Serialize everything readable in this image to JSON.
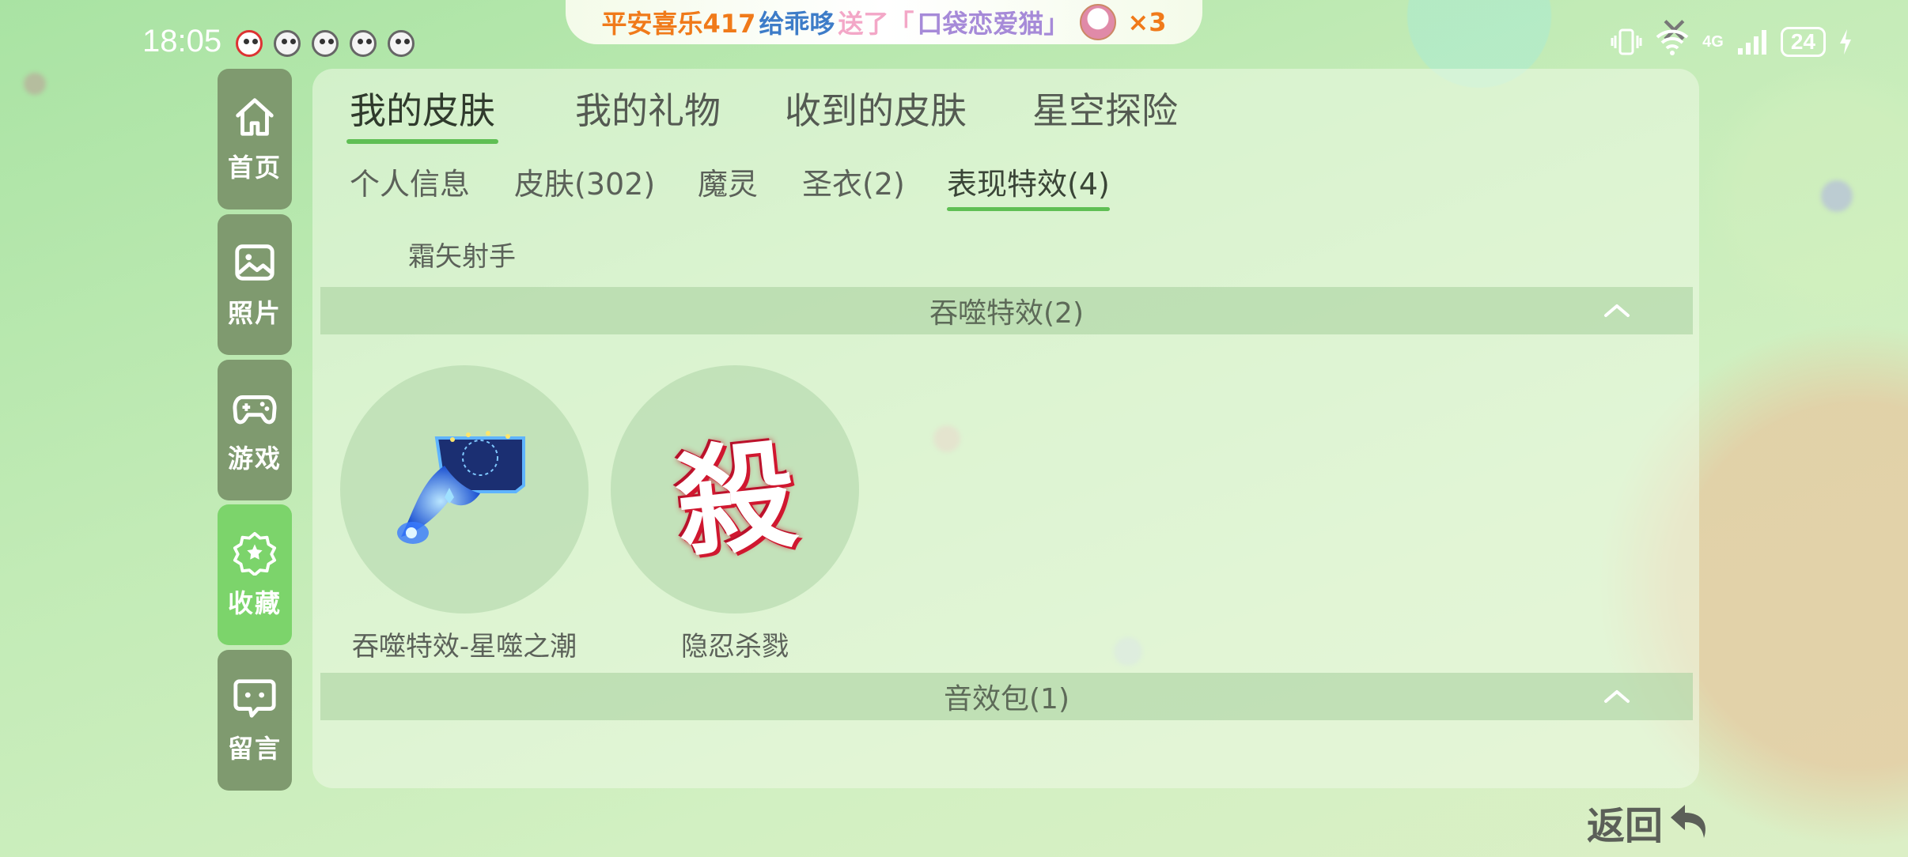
{
  "status_bar": {
    "time": "18:05",
    "network": "4G",
    "battery": "24"
  },
  "gift_banner": {
    "user": "平安喜乐417",
    "verb": "给乖哆",
    "action": "送了「",
    "item": "口袋恋爱猫」",
    "count": "×3"
  },
  "sidebar": {
    "items": [
      {
        "label": "首页",
        "icon": "home-icon"
      },
      {
        "label": "照片",
        "icon": "image-icon"
      },
      {
        "label": "游戏",
        "icon": "gamepad-icon"
      },
      {
        "label": "收藏",
        "icon": "star-badge-icon",
        "active": true
      },
      {
        "label": "留言",
        "icon": "message-icon"
      }
    ]
  },
  "main_tabs": [
    {
      "label": "我的皮肤",
      "active": true
    },
    {
      "label": "我的礼物"
    },
    {
      "label": "收到的皮肤"
    },
    {
      "label": "星空探险"
    }
  ],
  "sub_tabs": [
    {
      "label": "个人信息"
    },
    {
      "label": "皮肤(302)"
    },
    {
      "label": "魔灵"
    },
    {
      "label": "圣衣(2)"
    },
    {
      "label": "表现特效(4)",
      "active": true
    }
  ],
  "character_name": "霜矢射手",
  "sections": [
    {
      "title": "吞噬特效(2)",
      "expanded": true,
      "items": [
        {
          "label": "吞噬特效-星噬之潮",
          "icon": "star-tide-effect-icon"
        },
        {
          "label": "隐忍杀戮",
          "glyph": "殺"
        }
      ]
    },
    {
      "title": "音效包(1)",
      "expanded": true,
      "items": []
    }
  ],
  "back_button": {
    "label": "返回"
  },
  "colors": {
    "accent_green": "#5fbf54",
    "sidebar_active": "#7cd46b",
    "sidebar_default": "#7f9a6f"
  }
}
